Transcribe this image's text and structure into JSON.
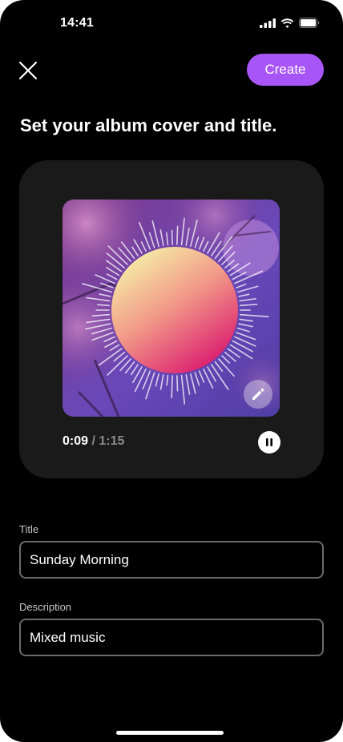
{
  "status_bar": {
    "time": "14:41",
    "icons": [
      "cellular-signal-icon",
      "wifi-icon",
      "battery-icon"
    ]
  },
  "header": {
    "close_icon": "close-icon",
    "create_label": "Create"
  },
  "heading": "Set your album cover and title.",
  "player": {
    "elapsed": "0:09",
    "separator": " / ",
    "total": "1:15",
    "progress_fraction": 0.12,
    "edit_icon": "pencil-icon",
    "pause_icon": "pause-icon"
  },
  "form": {
    "title_label": "Title",
    "title_value": "Sunday Morning",
    "description_label": "Description",
    "description_value": "Mixed music"
  },
  "colors": {
    "accent": "#a855f7",
    "background": "#000000",
    "card": "#1a1a1a",
    "field_border": "#6a6a6a"
  }
}
